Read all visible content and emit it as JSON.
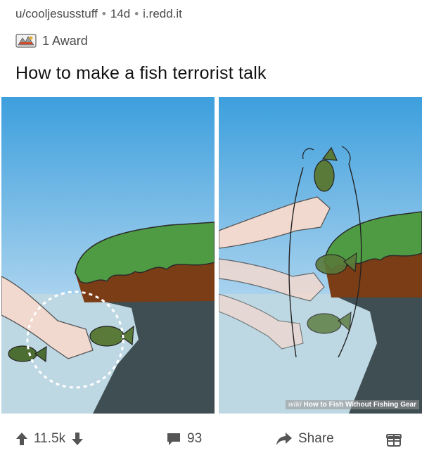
{
  "post": {
    "author": "u/cooljesusstuff",
    "age": "14d",
    "domain": "i.redd.it",
    "separator": "•",
    "award_text": "1 Award",
    "title": "How to make a fish terrorist talk"
  },
  "image": {
    "watermark_brand": "wiki",
    "watermark_text": "How to Fish Without Fishing Gear"
  },
  "actions": {
    "score": "11.5k",
    "comments": "93",
    "share_label": "Share"
  },
  "colors": {
    "sky": "#4aa8e0",
    "water": "#bcd6e2",
    "grass": "#4e9a44",
    "dirt": "#7a3e16",
    "water_shadow": "#3e4f55",
    "fish": "#5a7a3a"
  },
  "icons": {
    "award": "award-icon",
    "upvote": "upvote-icon",
    "downvote": "downvote-icon",
    "comment": "comment-icon",
    "share": "share-icon",
    "gift": "gift-icon"
  }
}
